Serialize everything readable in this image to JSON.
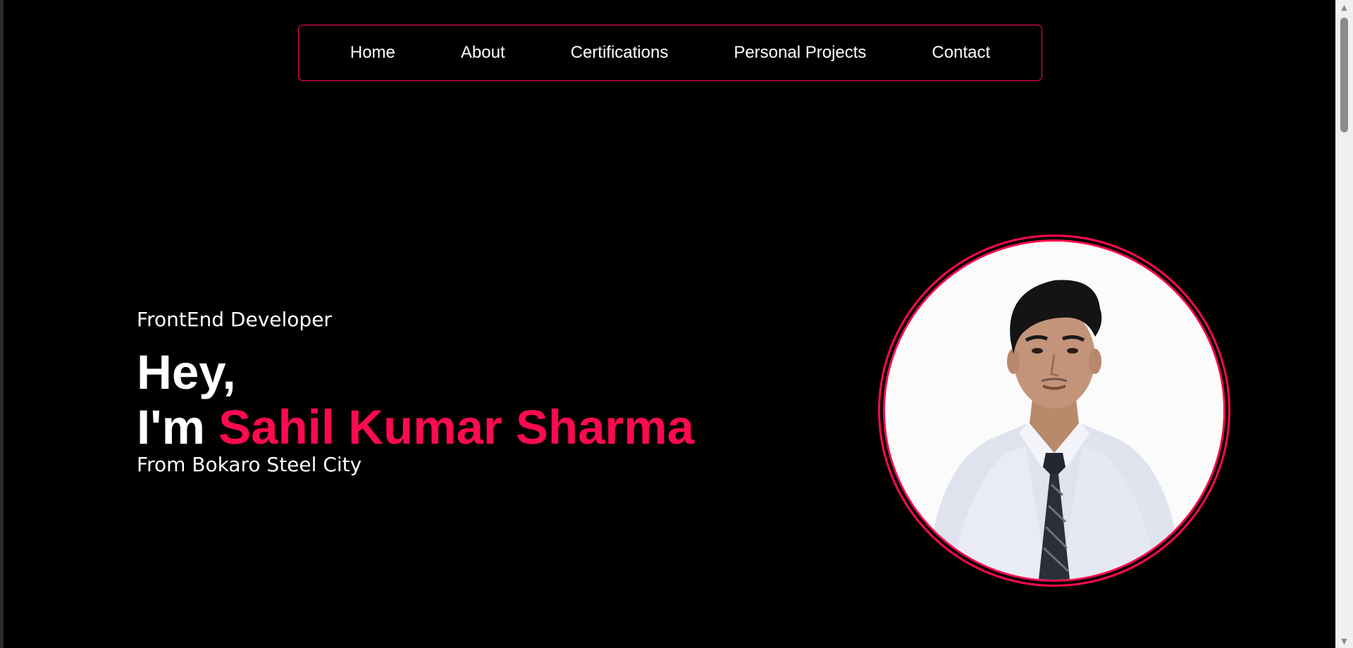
{
  "nav": {
    "items": [
      {
        "label": "Home"
      },
      {
        "label": "About"
      },
      {
        "label": "Certifications"
      },
      {
        "label": "Personal Projects"
      },
      {
        "label": "Contact"
      }
    ]
  },
  "hero": {
    "role": "FrontEnd Developer",
    "greeting": "Hey,",
    "intro": "I'm",
    "name": "Sahil Kumar Sharma",
    "location": "From Bokaro Steel City"
  },
  "colors": {
    "background": "#000000",
    "accent": "#ff0a4f",
    "text": "#ffffff"
  },
  "icons": {
    "scroll_up": "scroll-up-arrow-icon",
    "scroll_down": "scroll-down-arrow-icon"
  }
}
